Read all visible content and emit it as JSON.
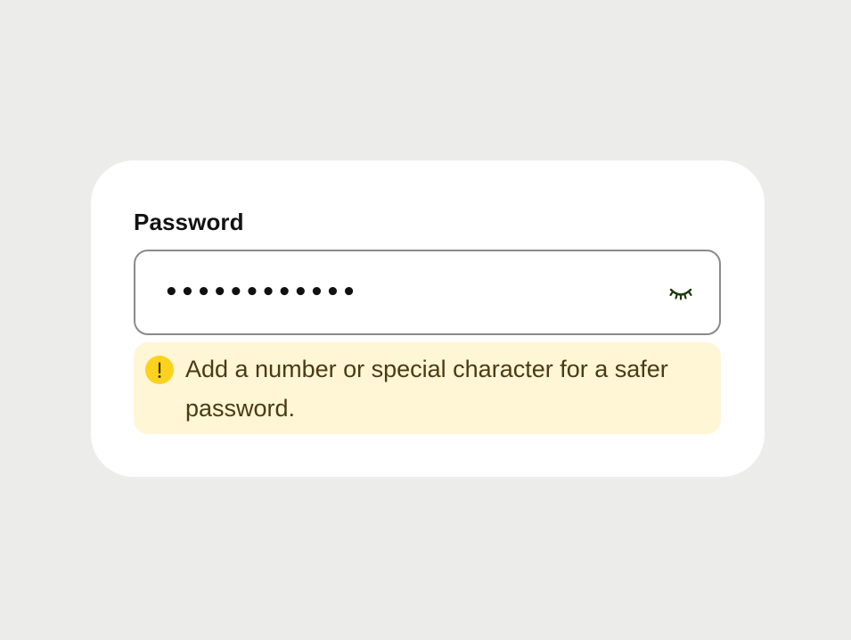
{
  "field": {
    "label": "Password",
    "masked_value": "••••••••••••",
    "visibility_toggle_icon": "eye-closed-icon"
  },
  "warning": {
    "icon": "exclamation-icon",
    "icon_glyph": "!",
    "message": "Add a number or special character for a safer password."
  },
  "colors": {
    "background": "#ecedea",
    "card": "#ffffff",
    "input_border": "#8a8a8a",
    "warning_bg": "#fff6d6",
    "warning_icon": "#fcd21f",
    "warning_text": "#4a3b12",
    "eye_icon": "#1d3a12"
  }
}
